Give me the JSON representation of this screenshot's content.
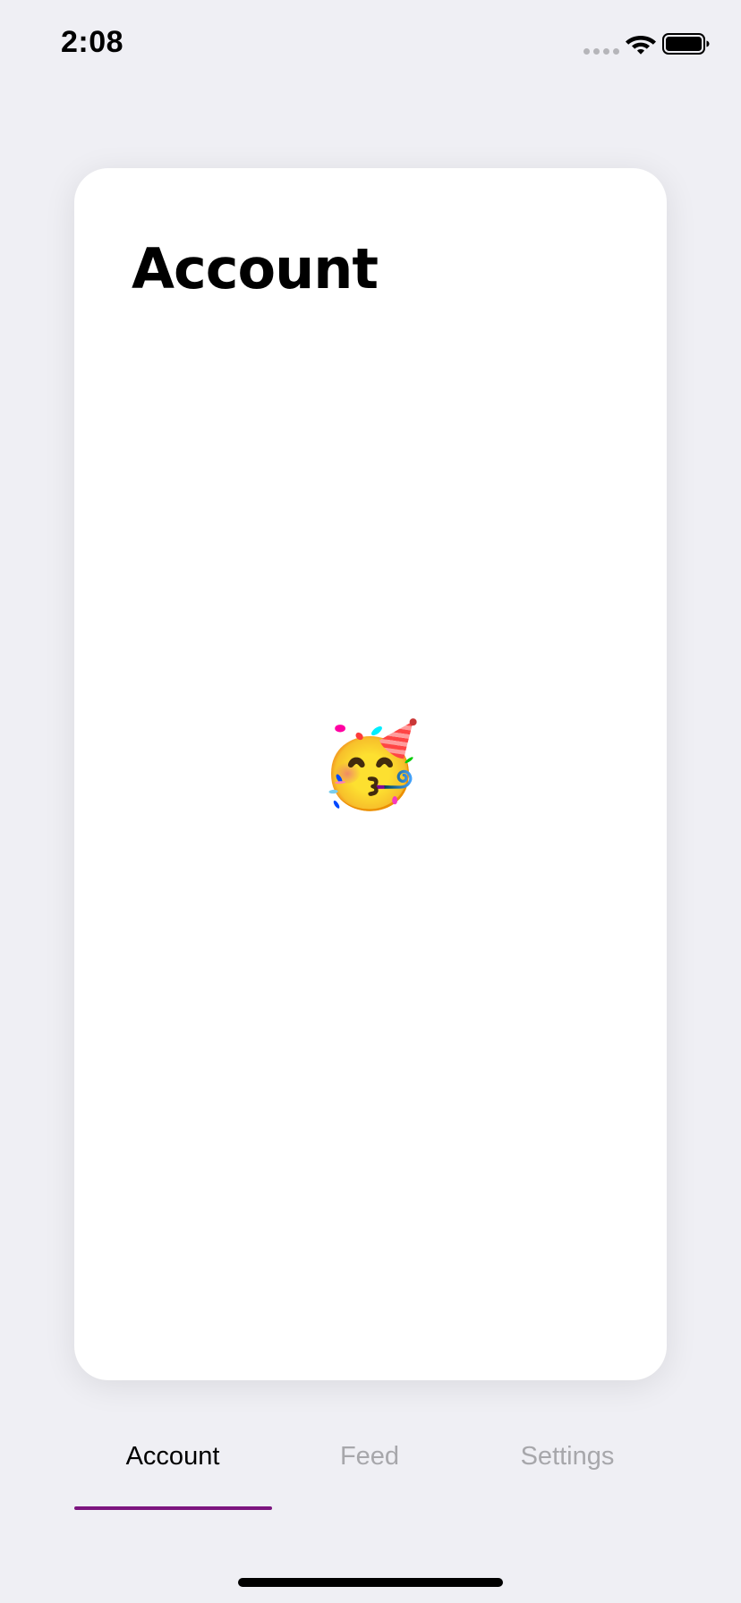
{
  "status_bar": {
    "time": "2:08",
    "icons": [
      "cellular-signal-icon",
      "wifi-icon",
      "battery-icon"
    ]
  },
  "card": {
    "title": "Account",
    "emoji": "🥳"
  },
  "tabs": [
    {
      "label": "Account",
      "selected": true
    },
    {
      "label": "Feed",
      "selected": false
    },
    {
      "label": "Settings",
      "selected": false
    }
  ],
  "colors": {
    "background": "#efeff4",
    "card": "#ffffff",
    "accent": "#7c157f",
    "tab_active": "#000000",
    "tab_inactive": "#a7a7ab"
  }
}
